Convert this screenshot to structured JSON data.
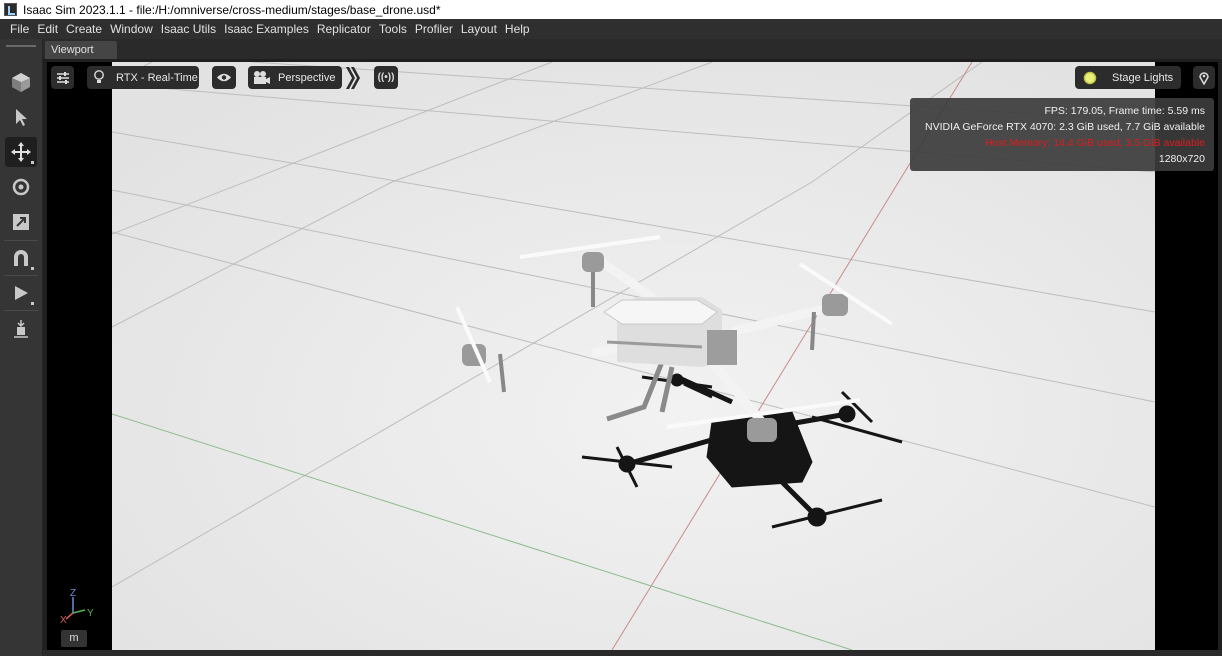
{
  "window": {
    "title": "Isaac Sim 2023.1.1 - file:/H:/omniverse/cross-medium/stages/base_drone.usd*"
  },
  "menu": [
    "File",
    "Edit",
    "Create",
    "Window",
    "Isaac Utils",
    "Isaac Examples",
    "Replicator",
    "Tools",
    "Profiler",
    "Layout",
    "Help"
  ],
  "tabs": {
    "viewport": "Viewport"
  },
  "viewport": {
    "renderer_label": "RTX - Real-Time",
    "camera_label": "Perspective",
    "lights_label": "Stage Lights",
    "stats": {
      "fps": "FPS: 179.05, Frame time: 5.59 ms",
      "gpu": "NVIDIA GeForce RTX 4070: 2.3 GiB used, 7.7 GiB available",
      "host_memory": "Host Memory: 14.4 GiB used, 3.5 GiB available",
      "resolution": "1280x720"
    },
    "axis": {
      "z": "Z",
      "x": "X",
      "y": "Y"
    },
    "mode": "m"
  },
  "colors": {
    "memory_warning": "#e01b1b",
    "floor": "#e9e9e9",
    "x_axis_line": "#c98a8a",
    "y_axis_line": "#8dbb8d"
  }
}
